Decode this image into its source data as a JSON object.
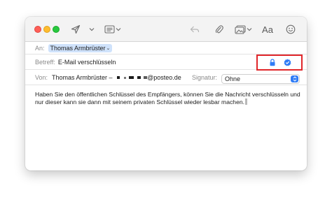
{
  "window": {
    "toolbar": {
      "icons": [
        "send-icon",
        "chevron-down-icon",
        "header-fields-icon",
        "chevron-down-icon",
        "reply-icon",
        "attachment-icon",
        "photo-browser-icon",
        "chevron-down-icon",
        "emoji-icon"
      ],
      "font_button_label": "Aa"
    },
    "to": {
      "label": "An:",
      "recipient": "Thomas Armbrüster"
    },
    "subject": {
      "label": "Betreff:",
      "value": "E-Mail verschlüsseln",
      "icons": [
        "lock-icon",
        "verified-icon"
      ],
      "highlight_color": "#e0262a"
    },
    "from": {
      "label": "Von:",
      "value_prefix": "Thomas Armbrüster –",
      "value_suffix": "@posteo.de",
      "signature_label": "Signatur:",
      "signature_value": "Ohne"
    },
    "message": {
      "text": "Haben Sie den öffentlichen Schlüssel des Empfängers, können Sie die Nachricht verschlüsseln und nur dieser kann sie dann mit seinem privaten Schlüssel wieder lesbar machen."
    }
  },
  "colors": {
    "accent": "#2f7cf6",
    "chip": "#cfe2fb",
    "close": "#fe5f57",
    "minimize": "#febc2e",
    "zoom": "#28c840"
  }
}
